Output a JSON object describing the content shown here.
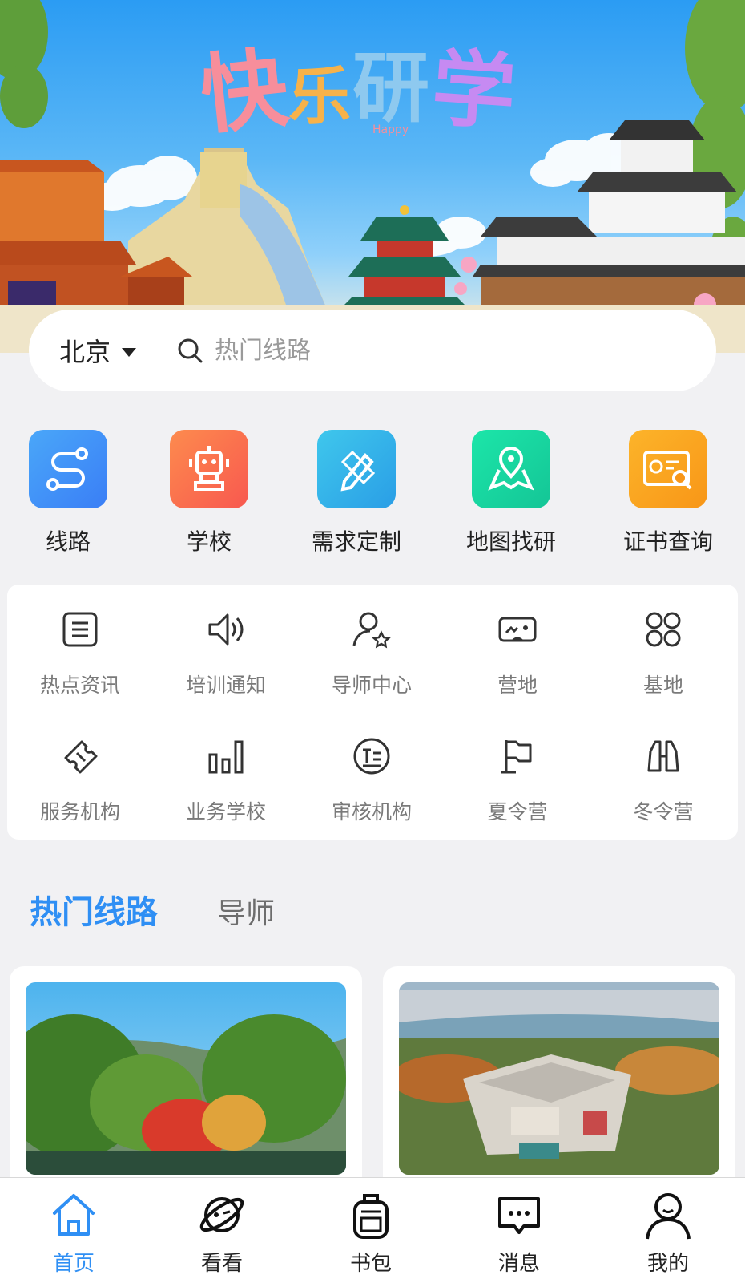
{
  "banner": {
    "logo_chars": [
      "快",
      "乐",
      "研",
      "学"
    ],
    "logo_sub": "Happy"
  },
  "search": {
    "city": "北京",
    "placeholder": "热门线路"
  },
  "quick_items": [
    {
      "label": "线路",
      "icon": "route-icon",
      "color": "#3d8ef8"
    },
    {
      "label": "学校",
      "icon": "robot-icon",
      "color": "#fb6f4e"
    },
    {
      "label": "需求定制",
      "icon": "pencil-ruler-icon",
      "color": "#2fb6ea"
    },
    {
      "label": "地图找研",
      "icon": "map-pin-icon",
      "color": "#19d79f"
    },
    {
      "label": "证书查询",
      "icon": "certificate-search-icon",
      "color": "#fba11e"
    }
  ],
  "grid_items": [
    {
      "label": "热点资讯",
      "icon": "news-icon"
    },
    {
      "label": "培训通知",
      "icon": "speaker-icon"
    },
    {
      "label": "导师中心",
      "icon": "user-star-icon"
    },
    {
      "label": "营地",
      "icon": "vr-goggles-icon"
    },
    {
      "label": "基地",
      "icon": "grid-circles-icon"
    },
    {
      "label": "服务机构",
      "icon": "ticket-icon"
    },
    {
      "label": "业务学校",
      "icon": "bar-chart-icon"
    },
    {
      "label": "审核机构",
      "icon": "text-circle-icon"
    },
    {
      "label": "夏令营",
      "icon": "flag-icon"
    },
    {
      "label": "冬令营",
      "icon": "binoculars-icon"
    }
  ],
  "tabs": {
    "active": "热门线路",
    "other": "导师"
  },
  "nav": [
    {
      "label": "首页",
      "icon": "home-icon",
      "active": true
    },
    {
      "label": "看看",
      "icon": "planet-icon",
      "active": false
    },
    {
      "label": "书包",
      "icon": "backpack-icon",
      "active": false
    },
    {
      "label": "消息",
      "icon": "message-icon",
      "active": false
    },
    {
      "label": "我的",
      "icon": "profile-icon",
      "active": false
    }
  ],
  "colors": {
    "accent": "#2f8ff4",
    "background": "#f1f1f3"
  }
}
